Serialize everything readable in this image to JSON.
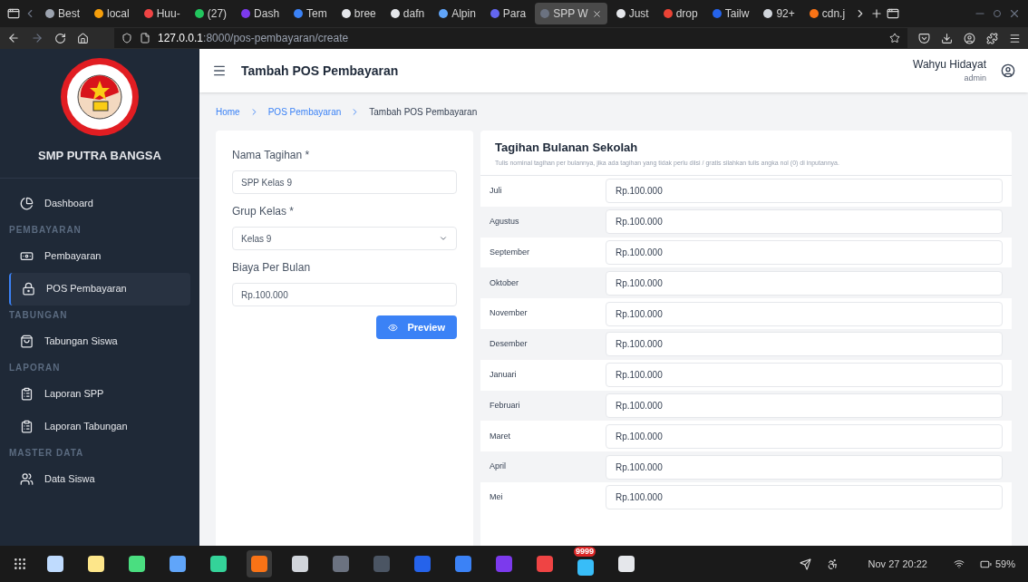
{
  "browser": {
    "tabs": [
      {
        "label": "Best",
        "color": "#9ca3af",
        "selected": false
      },
      {
        "label": "local",
        "color": "#f59e0b",
        "selected": false
      },
      {
        "label": "Huu-",
        "color": "#ef4444",
        "selected": false
      },
      {
        "label": "(27)",
        "color": "#22c55e",
        "selected": false
      },
      {
        "label": "Dash",
        "color": "#7c3aed",
        "selected": false
      },
      {
        "label": "Tem",
        "color": "#3b82f6",
        "selected": false
      },
      {
        "label": "bree",
        "color": "#e5e7eb",
        "selected": false
      },
      {
        "label": "dafn",
        "color": "#e5e7eb",
        "selected": false
      },
      {
        "label": "Alpin",
        "color": "#60a5fa",
        "selected": false
      },
      {
        "label": "Para",
        "color": "#6366f1",
        "selected": false
      },
      {
        "label": "SPP W",
        "color": "#6b7280",
        "selected": true
      },
      {
        "label": "Just",
        "color": "#e5e7eb",
        "selected": false
      },
      {
        "label": "drop",
        "color": "#ea4335",
        "selected": false
      },
      {
        "label": "Tailw",
        "color": "#2563eb",
        "selected": false
      },
      {
        "label": "92+",
        "color": "#d1d5db",
        "selected": false
      },
      {
        "label": "cdn.j",
        "color": "#f97316",
        "selected": false
      }
    ],
    "url_host": "127.0.0.1",
    "url_path": ":8000/pos-pembayaran/create"
  },
  "sidebar": {
    "school": "SMP PUTRA BANGSA",
    "items": [
      {
        "kind": "link",
        "label": "Dashboard",
        "selected": false
      },
      {
        "kind": "section",
        "label": "PEMBAYARAN"
      },
      {
        "kind": "link",
        "label": "Pembayaran",
        "selected": false
      },
      {
        "kind": "link",
        "label": "POS Pembayaran",
        "selected": true
      },
      {
        "kind": "section",
        "label": "TABUNGAN"
      },
      {
        "kind": "link",
        "label": "Tabungan Siswa",
        "selected": false
      },
      {
        "kind": "section",
        "label": "LAPORAN"
      },
      {
        "kind": "link",
        "label": "Laporan SPP",
        "selected": false
      },
      {
        "kind": "link",
        "label": "Laporan Tabungan",
        "selected": false
      },
      {
        "kind": "section",
        "label": "MASTER DATA"
      },
      {
        "kind": "link",
        "label": "Data Siswa",
        "selected": false
      }
    ]
  },
  "header": {
    "title": "Tambah POS Pembayaran",
    "user_name": "Wahyu Hidayat",
    "user_role": "admin"
  },
  "breadcrumb": [
    "Home",
    "POS Pembayaran",
    "Tambah POS Pembayaran"
  ],
  "form": {
    "fields": [
      {
        "kind": "text",
        "label": "Nama Tagihan *",
        "value": "SPP Kelas 9"
      },
      {
        "kind": "select",
        "label": "Grup Kelas *",
        "value": "Kelas 9"
      },
      {
        "kind": "text",
        "label": "Biaya Per Bulan",
        "value": "Rp.100.000"
      }
    ],
    "button": "Preview"
  },
  "monthly": {
    "title": "Tagihan Bulanan Sekolah",
    "note": "Tulis nominal tagihan per bulannya, jika ada tagihan yang tidak perlu diisi / gratis silahkan tulis angka nol (0) di inputannya.",
    "rows": [
      {
        "month": "Juli",
        "value": "Rp.100.000"
      },
      {
        "month": "Agustus",
        "value": "Rp.100.000"
      },
      {
        "month": "September",
        "value": "Rp.100.000"
      },
      {
        "month": "Oktober",
        "value": "Rp.100.000"
      },
      {
        "month": "November",
        "value": "Rp.100.000"
      },
      {
        "month": "Desember",
        "value": "Rp.100.000"
      },
      {
        "month": "Januari",
        "value": "Rp.100.000"
      },
      {
        "month": "Februari",
        "value": "Rp.100.000"
      },
      {
        "month": "Maret",
        "value": "Rp.100.000"
      },
      {
        "month": "April",
        "value": "Rp.100.000"
      },
      {
        "month": "Mei",
        "value": "Rp.100.000"
      }
    ]
  },
  "taskbar": {
    "apps": [
      {
        "color": "#bfdbfe",
        "selected": false
      },
      {
        "color": "#fde68a",
        "selected": false
      },
      {
        "color": "#4ade80",
        "selected": false
      },
      {
        "color": "#60a5fa",
        "selected": false
      },
      {
        "color": "#34d399",
        "selected": false
      },
      {
        "color": "#f97316",
        "selected": true
      },
      {
        "color": "#d1d5db",
        "selected": false
      },
      {
        "color": "#6b7280",
        "selected": false
      },
      {
        "color": "#4b5563",
        "selected": false
      },
      {
        "color": "#2563eb",
        "selected": false
      },
      {
        "color": "#3b82f6",
        "selected": false
      },
      {
        "color": "#7c3aed",
        "selected": false
      },
      {
        "color": "#ef4444",
        "selected": false
      },
      {
        "color": "#38bdf8",
        "selected": false,
        "badge": "9999"
      },
      {
        "color": "#e5e7eb",
        "selected": false
      }
    ],
    "clock": "Nov 27 20:22",
    "battery": "59%"
  }
}
